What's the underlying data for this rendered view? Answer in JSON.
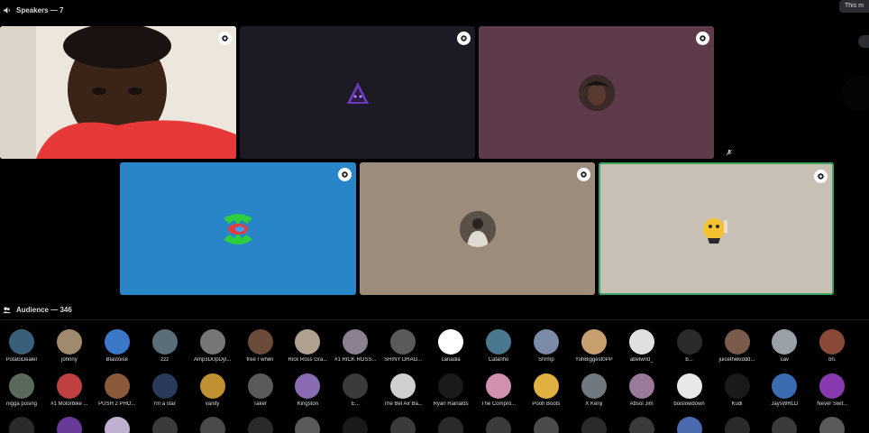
{
  "speakers": {
    "header": "Speakers — 7",
    "tooltip": "This m"
  },
  "audience": {
    "header": "Audience — 346",
    "row1": [
      {
        "name": "PotatoDealer",
        "color": "#3a5f7a"
      },
      {
        "name": "johnny",
        "color": "#a08a6e"
      },
      {
        "name": "Blastoise",
        "color": "#3c78c8"
      },
      {
        "name": "zzz",
        "color": "#5a6e7a"
      },
      {
        "name": "Amp3DUpDyl...",
        "color": "#777777"
      },
      {
        "name": "free r when",
        "color": "#6b4a3a"
      },
      {
        "name": "Rick Ross Gra...",
        "color": "#b0a090"
      },
      {
        "name": "#1 RICK ROSS...",
        "color": "#8a8090"
      },
      {
        "name": "SHINY DRAG...",
        "color": "#5a5a5a"
      },
      {
        "name": "canadia",
        "color": "#ffffff"
      },
      {
        "name": "Catanho",
        "color": "#4a7890"
      },
      {
        "name": "SlVmp",
        "color": "#7a8aa8"
      },
      {
        "name": "YuhBiggest0PP",
        "color": "#c8a070"
      },
      {
        "name": "abelwrld_",
        "color": "#e0e0e0"
      },
      {
        "name": "b...",
        "color": "#2a2a2a"
      },
      {
        "name": "juicethekiddd...",
        "color": "#7a5a4a"
      },
      {
        "name": "cav",
        "color": "#9aa0a8"
      },
      {
        "name": "bn.",
        "color": "#8a4a3a"
      }
    ],
    "row2": [
      {
        "name": "nigga posing",
        "color": "#5a6a5a"
      },
      {
        "name": "#1 Motorbike ...",
        "color": "#c04040"
      },
      {
        "name": "PUSH 2 PHO...",
        "color": "#8a5a3a"
      },
      {
        "name": "i'm a star",
        "color": "#2a3a5a"
      },
      {
        "name": "vanity",
        "color": "#c09030"
      },
      {
        "name": "Taker",
        "color": "#5a5a5a"
      },
      {
        "name": "Kingston",
        "color": "#8a6ab0"
      },
      {
        "name": "E...",
        "color": "#3a3a3a"
      },
      {
        "name": "The Bel Air Ba...",
        "color": "#d0d0d0"
      },
      {
        "name": "Ryan Rainalds",
        "color": "#1a1a1a"
      },
      {
        "name": "The Compro...",
        "color": "#d090b0"
      },
      {
        "name": "Pooh Boots",
        "color": "#e0b040"
      },
      {
        "name": "X Kenji",
        "color": "#707880"
      },
      {
        "name": "Absol Jim",
        "color": "#9a7a9a"
      },
      {
        "name": "boislowdown",
        "color": "#e8e8e8"
      },
      {
        "name": "Kudi",
        "color": "#1a1a1a"
      },
      {
        "name": "JaysWRLD",
        "color": "#3a6ab0"
      },
      {
        "name": "Never Swit...",
        "color": "#8a3ab0"
      }
    ],
    "row3_colors": [
      "#2a2a2a",
      "#6a3a9a",
      "#c0b0d0",
      "#3a3a3a",
      "#4a4a4a",
      "#2a2a2a",
      "#5a5a5a",
      "#1a1a1a",
      "#3a3a3a",
      "#2a2a2a",
      "#3a3a3a",
      "#4a4a4a",
      "#2a2a2a",
      "#3a3a3a",
      "#4a6ab0",
      "#2a2a2a",
      "#3a3a3a",
      "#5a5a5a"
    ]
  },
  "colors": {
    "tile_dark_purple": "#1c1a24",
    "tile_mauve": "#5e3b4a",
    "tile_blue": "#2886c8",
    "tile_taupe": "#9c8c7b",
    "tile_beige": "#c8c0b4",
    "active_border": "#3ba55c"
  }
}
